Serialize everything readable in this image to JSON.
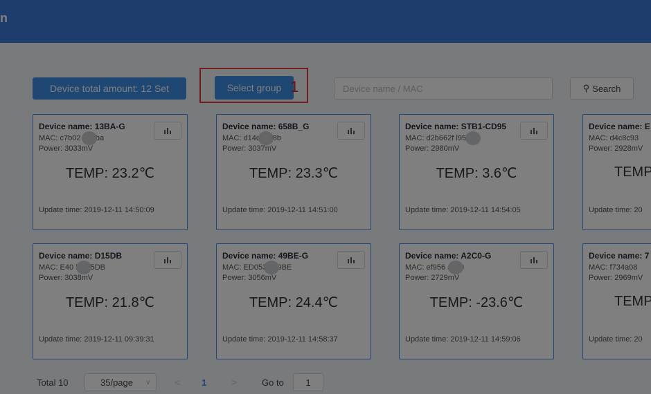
{
  "header": {
    "glyph": "n"
  },
  "toolbar": {
    "total_label": "Device total amount: 12 Set",
    "select_group_label": "Select group",
    "marker_number": "1",
    "search_placeholder": "Device name / MAC",
    "search_label": "Search"
  },
  "cards": [
    {
      "name": "Device name: 13BA-G",
      "mac": "MAC:  c7b02   413ba",
      "power": "Power: 3033mV",
      "temp": "TEMP: 23.2℃",
      "update": "Update time: 2019-12-11 14:50:09"
    },
    {
      "name": "Device name: 658B_G",
      "mac": "MAC:  d14c    f658b",
      "power": "Power: 3037mV",
      "temp": "TEMP: 23.3℃",
      "update": "Update time: 2019-12-11 14:51:00"
    },
    {
      "name": "Device name: STB1-CD95",
      "mac": "MAC:  d2b662f     l95",
      "power": "Power: 2980mV",
      "temp": "TEMP: 3.6℃",
      "update": "Update time: 2019-12-11 14:54:05"
    },
    {
      "name": "Device name: E",
      "mac": "MAC:  d4c8c93",
      "power": "Power: 2928mV",
      "temp": "TEMP",
      "update": "Update time: 20"
    },
    {
      "name": "Device name: D15DB",
      "mac": "MAC:  E40   BD15DB",
      "power": "Power: 3038mV",
      "temp": "TEMP: 21.8℃",
      "update": "Update time: 2019-12-11 09:39:31"
    },
    {
      "name": "Device name: 49BE-G",
      "mac": "MAC:  ED053    049BE",
      "power": "Power: 3056mV",
      "temp": "TEMP: 24.4℃",
      "update": "Update time: 2019-12-11 14:58:37"
    },
    {
      "name": "Device name: A2C0-G",
      "mac": "MAC:  ef956    a2c0",
      "power": "Power: 2729mV",
      "temp": "TEMP: -23.6℃",
      "update": "Update time: 2019-12-11 14:59:06"
    },
    {
      "name": "Device name: 7",
      "mac": "MAC:  f734a08",
      "power": "Power: 2969mV",
      "temp": "TEMP",
      "update": "Update time: 20"
    }
  ],
  "pagination": {
    "total_label": "Total 10",
    "page_size": "35/page",
    "prev": "<",
    "current_page": "1",
    "next": ">",
    "goto_label": "Go to",
    "goto_value": "1"
  }
}
